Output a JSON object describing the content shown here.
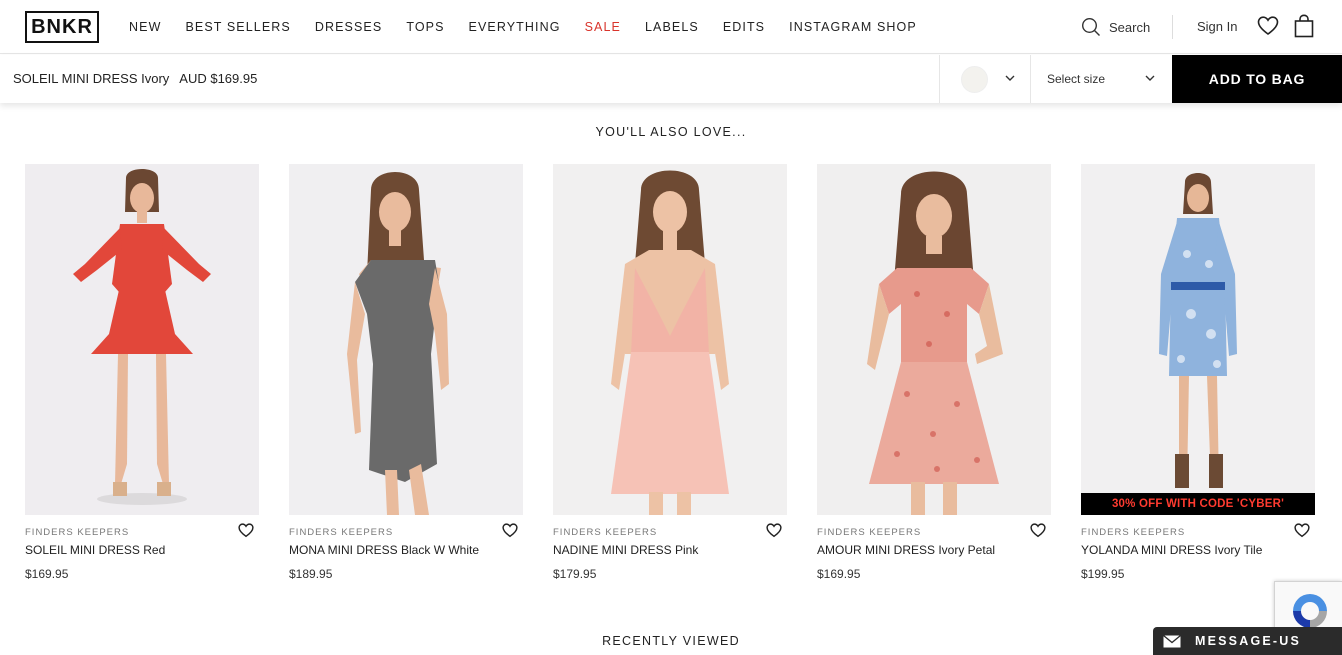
{
  "header": {
    "logo": "BNKR",
    "nav": [
      {
        "label": "NEW"
      },
      {
        "label": "BEST SELLERS"
      },
      {
        "label": "DRESSES"
      },
      {
        "label": "TOPS"
      },
      {
        "label": "EVERYTHING"
      },
      {
        "label": "SALE",
        "color": "#d9342b"
      },
      {
        "label": "LABELS"
      },
      {
        "label": "EDITS"
      },
      {
        "label": "INSTAGRAM SHOP"
      }
    ],
    "search_label": "Search",
    "signin_label": "Sign In",
    "icons": [
      "search-icon",
      "heart-icon",
      "bag-icon"
    ]
  },
  "sticky_bar": {
    "product_name": "SOLEIL MINI DRESS Ivory",
    "product_price": "AUD $169.95",
    "swatch_color": "#f3f2ee",
    "size_placeholder": "Select size",
    "add_to_bag_label": "ADD TO BAG"
  },
  "also_love": {
    "title": "YOU'LL ALSO LOVE...",
    "products": [
      {
        "brand": "FINDERS KEEPERS",
        "title": "SOLEIL MINI DRESS Red",
        "price": "$169.95",
        "dress_color": "#e2473a"
      },
      {
        "brand": "FINDERS KEEPERS",
        "title": "MONA MINI DRESS Black W White",
        "price": "$189.95",
        "dress_color": "#6a6a6a"
      },
      {
        "brand": "FINDERS KEEPERS",
        "title": "NADINE MINI DRESS Pink",
        "price": "$179.95",
        "dress_color": "#f2b3a6"
      },
      {
        "brand": "FINDERS KEEPERS",
        "title": "AMOUR MINI DRESS Ivory Petal",
        "price": "$169.95",
        "dress_color": "#e79a8c"
      },
      {
        "brand": "FINDERS KEEPERS",
        "title": "YOLANDA MINI DRESS Ivory Tile",
        "price": "$199.95",
        "dress_color": "#8fb3dd",
        "promo": "30% OFF WITH CODE 'CYBER'"
      }
    ]
  },
  "recently_viewed": {
    "title": "RECENTLY VIEWED"
  },
  "chat": {
    "label": "MESSAGE-US"
  }
}
